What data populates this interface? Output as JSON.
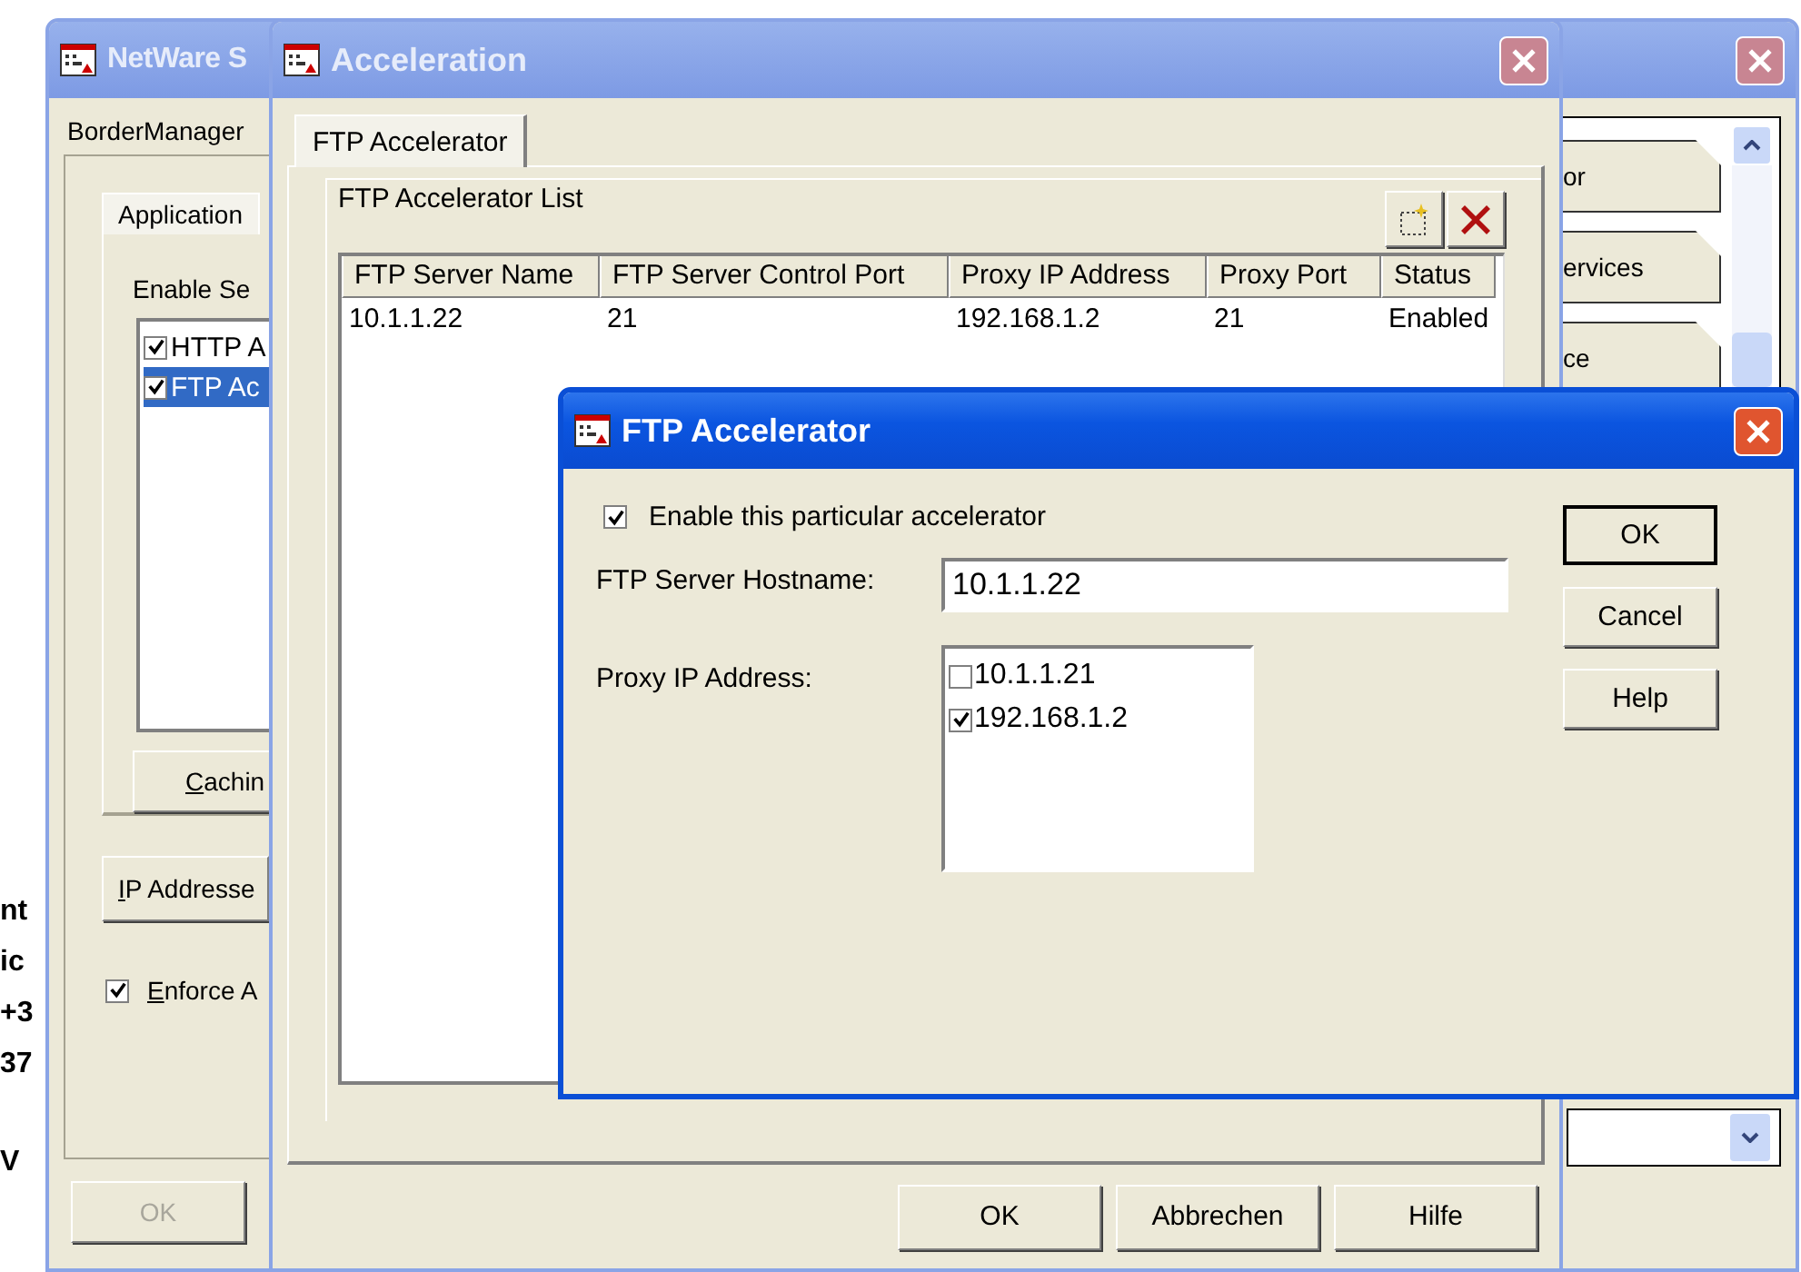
{
  "background_window": {
    "texts": [
      "nt",
      "ic",
      "+3",
      "37",
      "V"
    ]
  },
  "netware_window": {
    "title": "NetWare S",
    "tab": "BorderManager",
    "group_tab": "Application",
    "enable_label": "Enable Se",
    "services": [
      {
        "label": "HTTP A",
        "checked": true,
        "selected": false
      },
      {
        "label": "FTP Ac",
        "checked": true,
        "selected": true
      }
    ],
    "caching_button": "Cachin",
    "ip_button": "IP Addresse",
    "enforce": {
      "label": "Enforce A",
      "checked": true
    },
    "ok_button": {
      "label": "OK",
      "disabled": true
    },
    "side_buttons": [
      "or",
      "ervices",
      "ce"
    ]
  },
  "acceleration_window": {
    "title": "Acceleration",
    "tabs": [
      {
        "label": "FTP Accelerator",
        "selected": true
      }
    ],
    "list_title": "FTP Accelerator List",
    "table": {
      "columns": [
        "FTP Server Name",
        "FTP Server Control Port",
        "Proxy IP Address",
        "Proxy Port",
        "Status"
      ],
      "rows": [
        [
          "10.1.1.22",
          "21",
          "192.168.1.2",
          "21",
          "Enabled"
        ]
      ]
    },
    "buttons": [
      "OK",
      "Abbrechen",
      "Hilfe"
    ]
  },
  "ftp_dialog": {
    "title": "FTP Accelerator",
    "enable": {
      "label": "Enable this particular accelerator",
      "checked": true
    },
    "hostname": {
      "label": "FTP Server Hostname:",
      "value": "10.1.1.22"
    },
    "proxy": {
      "label": "Proxy IP Address:",
      "items": [
        {
          "label": "10.1.1.21",
          "checked": false
        },
        {
          "label": "192.168.1.2",
          "checked": true
        }
      ]
    },
    "buttons": [
      "OK",
      "Cancel",
      "Help"
    ]
  }
}
